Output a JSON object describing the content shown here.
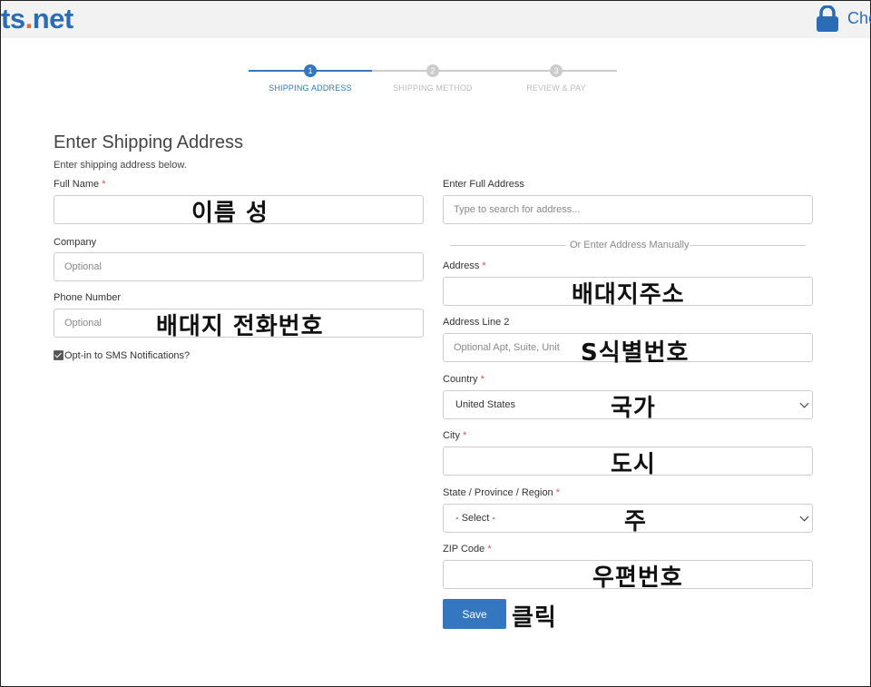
{
  "header": {
    "logo_main": "ts",
    "logo_dot": ".",
    "logo_tld": "net",
    "checkout_text": "Che"
  },
  "steps": [
    {
      "number": "1",
      "label": "SHIPPING ADDRESS",
      "active": true
    },
    {
      "number": "2",
      "label": "SHIPPING METHOD",
      "active": false
    },
    {
      "number": "3",
      "label": "REVIEW & PAY",
      "active": false
    }
  ],
  "form": {
    "title": "Enter Shipping Address",
    "subtitle": "Enter shipping address below.",
    "full_name": {
      "label": "Full Name",
      "required": "*",
      "overlay": "이름 성"
    },
    "company": {
      "label": "Company",
      "placeholder": "Optional"
    },
    "phone": {
      "label": "Phone Number",
      "placeholder": "Optional",
      "overlay": "배대지 전화번호"
    },
    "sms_opt_in": {
      "label": "Opt-in to SMS Notifications?",
      "checked": true
    },
    "full_address": {
      "label": "Enter Full Address",
      "placeholder": "Type to search for address..."
    },
    "divider_text": "Or Enter Address Manually",
    "address": {
      "label": "Address",
      "required": "*",
      "overlay": "배대지주소"
    },
    "address2": {
      "label": "Address Line 2",
      "placeholder": "Optional Apt, Suite, Unit",
      "overlay": "S식별번호"
    },
    "country": {
      "label": "Country",
      "required": "*",
      "value": "United States",
      "overlay": "국가"
    },
    "city": {
      "label": "City",
      "required": "*",
      "overlay": "도시"
    },
    "state": {
      "label": "State / Province / Region",
      "required": "*",
      "value": "- Select -",
      "overlay": "주"
    },
    "zip": {
      "label": "ZIP Code",
      "required": "*",
      "overlay": "우편번호"
    },
    "save_label": "Save",
    "save_overlay": "클릭"
  },
  "colors": {
    "accent": "#3477c0",
    "required": "#d9534f",
    "logo_blue": "#2a6db5",
    "logo_orange": "#e8683a"
  }
}
